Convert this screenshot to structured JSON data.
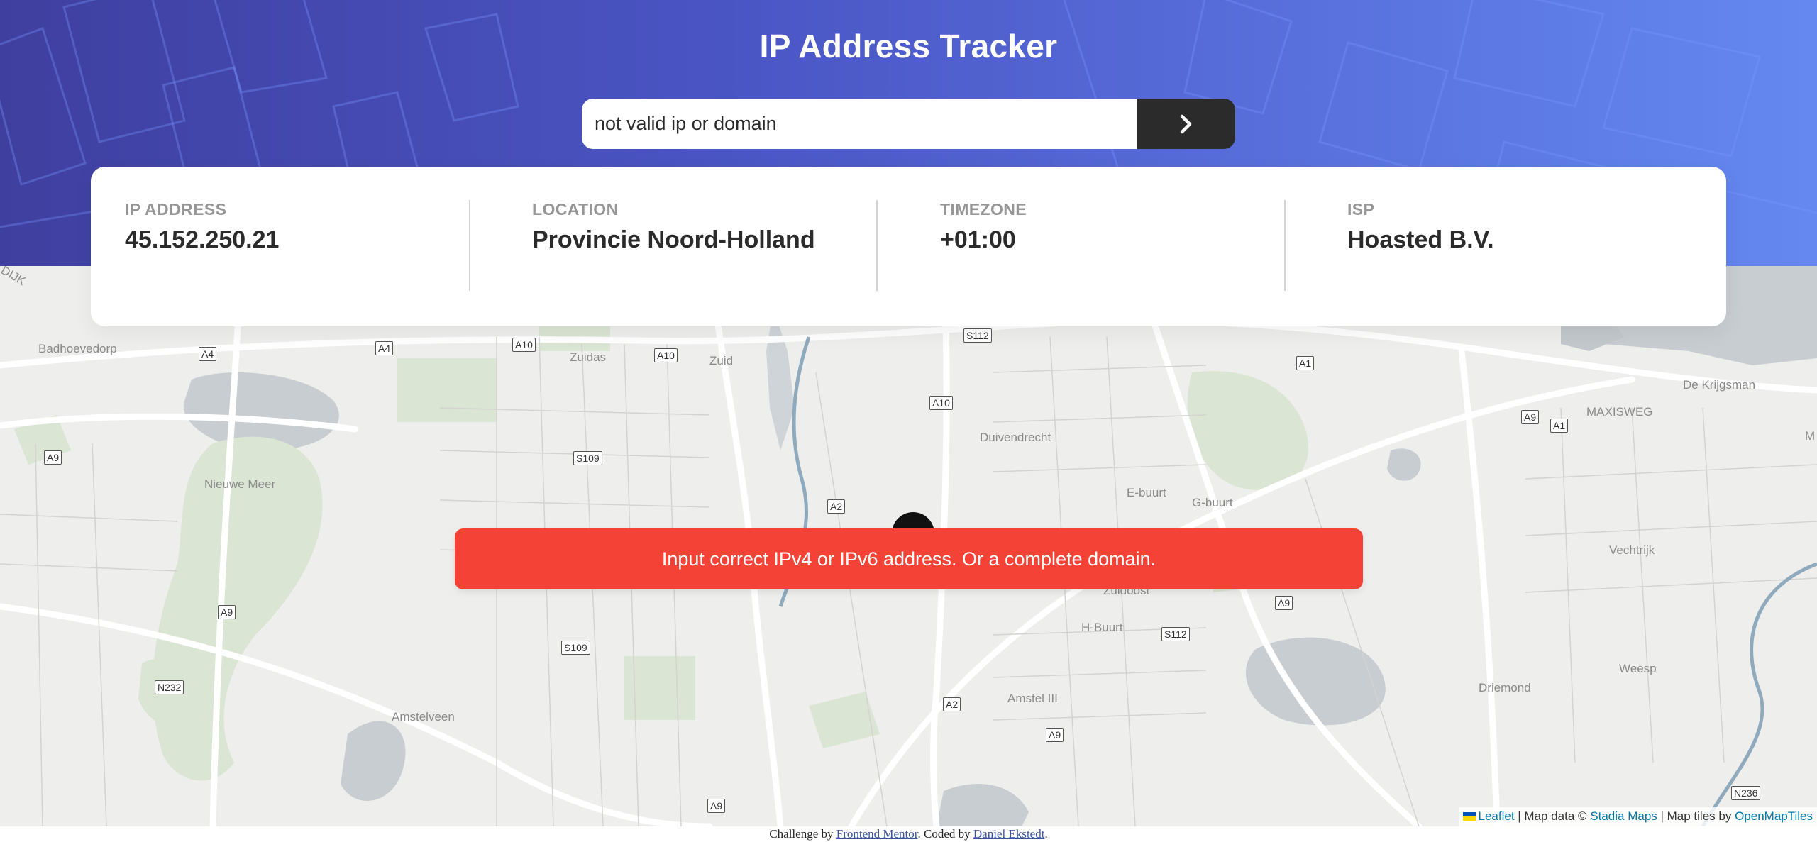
{
  "header": {
    "title": "IP Address Tracker",
    "search_value": "not valid ip or domain",
    "search_button_icon": "chevron-right-icon"
  },
  "info": [
    {
      "label": "IP ADDRESS",
      "value": "45.152.250.21"
    },
    {
      "label": "LOCATION",
      "value": "Provincie Noord-Holland"
    },
    {
      "label": "TIMEZONE",
      "value": "+01:00"
    },
    {
      "label": "ISP",
      "value": "Hoasted B.V."
    }
  ],
  "error": {
    "message": "Input correct IPv4 or IPv6 address. Or a complete domain."
  },
  "map": {
    "place_labels": {
      "badhoevedorp": "Badhoevedorp",
      "nieuwe_meer": "Nieuwe Meer",
      "amstelveen": "Amstelveen",
      "zuidas": "Zuidas",
      "zuid": "Zuid",
      "duivendrecht": "Duivendrecht",
      "e_buurt": "E-buurt",
      "g_buurt": "G-buurt",
      "zuidoost": "Zuidoost",
      "h_buurt": "H-Buurt",
      "amstel_iii": "Amstel III",
      "weesp": "Weesp",
      "driemond": "Driemond",
      "vechtrijk": "Vechtrijk",
      "maxisweg": "MAXISWEG",
      "de_krijgsman": "De Krijgsman",
      "dijk": "DIJK",
      "m": "M"
    },
    "road_shields": {
      "a4_1": "A4",
      "a4_2": "A4",
      "a10_1": "A10",
      "a10_2": "A10",
      "a10_3": "A10",
      "s112_1": "S112",
      "s112_2": "S112",
      "a1_1": "A1",
      "a1_2": "A1",
      "a9_1": "A9",
      "a9_2": "A9",
      "a9_3": "A9",
      "a9_4": "A9",
      "a9_5": "A9",
      "a9_6": "A9",
      "s109_1": "S109",
      "s109_2": "S109",
      "a2_1": "A2",
      "a2_2": "A2",
      "n232": "N232",
      "n236": "N236"
    },
    "attribution": {
      "leaflet": "Leaflet",
      "sep1": " | Map data © ",
      "stadia": "Stadia Maps",
      "sep2": " | Map tiles by ",
      "omt": "OpenMapTiles"
    },
    "colors": {
      "water": "#c8cdd1",
      "park": "#dbe5d3",
      "land": "#eeeeec",
      "road": "#ffffff"
    }
  },
  "footer": {
    "prefix": "Challenge by ",
    "fm_link": "Frontend Mentor",
    "middle": ". Coded by ",
    "author_link": "Daniel Ekstedt",
    "suffix": "."
  },
  "colors": {
    "error": "#f44336",
    "button": "#2b2b2b",
    "header_start": "#3f3f9f",
    "header_end": "#6488f0"
  }
}
